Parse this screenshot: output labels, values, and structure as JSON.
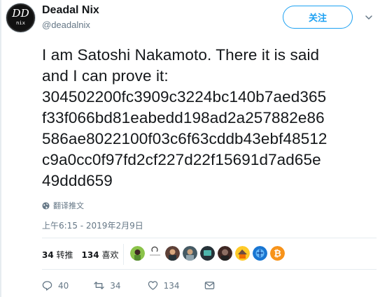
{
  "author": {
    "name": "Deadal Nix",
    "handle": "@deadalnix",
    "avatar_text": "nix"
  },
  "follow_button": {
    "label": "关注"
  },
  "tweet": {
    "lines": [
      "I am Satoshi Nakamoto. There it is said",
      "and I can prove it:",
      "304502200fc3909c3224bc140b7aed365",
      "f33f066bd81eabedd198ad2a257882e86",
      "586ae8022100f03c6f63cddb43ebf48512",
      "c9a0cc0f97fd2cf227d22f15691d7ad65e",
      "49ddd659"
    ]
  },
  "translate_label": "翻译推文",
  "timestamp": "上午6:15 - 2019年2月9日",
  "stats": {
    "retweets_count": "34",
    "retweets_label": "转推",
    "likes_count": "134",
    "likes_label": "喜欢"
  },
  "actions": {
    "replies": "40",
    "retweets": "34",
    "likes": "134"
  },
  "colors": {
    "accent": "#1da1f2",
    "muted": "#657786",
    "text": "#14171a",
    "divider": "#e6ecf0"
  },
  "icons": [
    "globe-icon",
    "caret-down-icon",
    "reply-icon",
    "retweet-icon",
    "heart-icon",
    "dm-icon"
  ]
}
